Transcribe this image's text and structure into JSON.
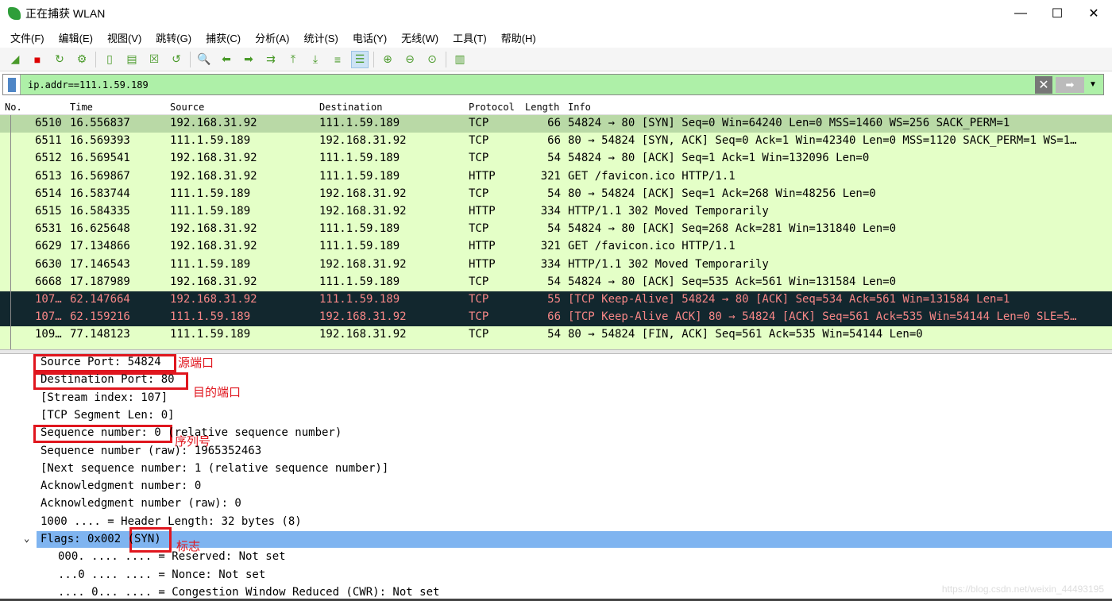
{
  "window": {
    "title": "正在捕获 WLAN",
    "minimize": "—",
    "maximize": "☐",
    "close": "✕"
  },
  "menu": [
    "文件(F)",
    "编辑(E)",
    "视图(V)",
    "跳转(G)",
    "捕获(C)",
    "分析(A)",
    "统计(S)",
    "电话(Y)",
    "无线(W)",
    "工具(T)",
    "帮助(H)"
  ],
  "toolbar": [
    "shark-fin-icon",
    "stop-icon",
    "restart-icon",
    "options-icon",
    "open-icon",
    "save-icon",
    "close-file-icon",
    "reload-icon",
    "find-icon",
    "back-icon",
    "forward-icon",
    "go-to-packet-icon",
    "first-packet-icon",
    "last-packet-icon",
    "autoscroll-icon",
    "colorize-icon",
    "zoom-in-icon",
    "zoom-out-icon",
    "zoom-normal-icon",
    "resize-columns-icon"
  ],
  "filter": {
    "value": "ip.addr==111.1.59.189"
  },
  "columns": [
    "No.",
    "Time",
    "Source",
    "Destination",
    "Protocol",
    "Length",
    "Info"
  ],
  "packets": [
    [
      "6510",
      "16.556837",
      "192.168.31.92",
      "111.1.59.189",
      "TCP",
      "66",
      "54824 → 80 [SYN] Seq=0 Win=64240 Len=0 MSS=1460 WS=256 SACK_PERM=1"
    ],
    [
      "6511",
      "16.569393",
      "111.1.59.189",
      "192.168.31.92",
      "TCP",
      "66",
      "80 → 54824 [SYN, ACK] Seq=0 Ack=1 Win=42340 Len=0 MSS=1120 SACK_PERM=1 WS=1…"
    ],
    [
      "6512",
      "16.569541",
      "192.168.31.92",
      "111.1.59.189",
      "TCP",
      "54",
      "54824 → 80 [ACK] Seq=1 Ack=1 Win=132096 Len=0"
    ],
    [
      "6513",
      "16.569867",
      "192.168.31.92",
      "111.1.59.189",
      "HTTP",
      "321",
      "GET /favicon.ico HTTP/1.1"
    ],
    [
      "6514",
      "16.583744",
      "111.1.59.189",
      "192.168.31.92",
      "TCP",
      "54",
      "80 → 54824 [ACK] Seq=1 Ack=268 Win=48256 Len=0"
    ],
    [
      "6515",
      "16.584335",
      "111.1.59.189",
      "192.168.31.92",
      "HTTP",
      "334",
      "HTTP/1.1 302 Moved Temporarily"
    ],
    [
      "6531",
      "16.625648",
      "192.168.31.92",
      "111.1.59.189",
      "TCP",
      "54",
      "54824 → 80 [ACK] Seq=268 Ack=281 Win=131840 Len=0"
    ],
    [
      "6629",
      "17.134866",
      "192.168.31.92",
      "111.1.59.189",
      "HTTP",
      "321",
      "GET /favicon.ico HTTP/1.1"
    ],
    [
      "6630",
      "17.146543",
      "111.1.59.189",
      "192.168.31.92",
      "HTTP",
      "334",
      "HTTP/1.1 302 Moved Temporarily"
    ],
    [
      "6668",
      "17.187989",
      "192.168.31.92",
      "111.1.59.189",
      "TCP",
      "54",
      "54824 → 80 [ACK] Seq=535 Ack=561 Win=131584 Len=0"
    ],
    [
      "107…",
      "62.147664",
      "192.168.31.92",
      "111.1.59.189",
      "TCP",
      "55",
      "[TCP Keep-Alive] 54824 → 80 [ACK] Seq=534 Ack=561 Win=131584 Len=1"
    ],
    [
      "107…",
      "62.159216",
      "111.1.59.189",
      "192.168.31.92",
      "TCP",
      "66",
      "[TCP Keep-Alive ACK] 80 → 54824 [ACK] Seq=561 Ack=535 Win=54144 Len=0 SLE=5…"
    ],
    [
      "109…",
      "77.148123",
      "111.1.59.189",
      "192.168.31.92",
      "TCP",
      "54",
      "80 → 54824 [FIN, ACK] Seq=561 Ack=535 Win=54144 Len=0"
    ]
  ],
  "details": [
    "Source Port: 54824",
    "Destination Port: 80",
    "[Stream index: 107]",
    "[TCP Segment Len: 0]",
    "Sequence number: 0    (relative sequence number)",
    "Sequence number (raw): 1965352463",
    "[Next sequence number: 1    (relative sequence number)]",
    "Acknowledgment number: 0",
    "Acknowledgment number (raw): 0",
    "1000 .... = Header Length: 32 bytes (8)",
    "Flags: 0x002 (SYN)",
    "000. .... .... = Reserved: Not set",
    "...0 .... .... = Nonce: Not set",
    ".... 0... .... = Congestion Window Reduced (CWR): Not set"
  ],
  "annotations": {
    "source_port": "源端口",
    "dest_port": "目的端口",
    "seq": "序列号",
    "flags": "标志"
  },
  "watermark": "https://blog.csdn.net/weixin_44493195",
  "colors": {
    "row_bg": "#e4ffc7",
    "selected_row": "#b9d9a6",
    "keepalive_bg": "#12272e",
    "keepalive_fg": "#f78787",
    "filter_bg": "#aef0a8",
    "highlight": "#7fb4f0",
    "annotation": "#e0161e"
  }
}
